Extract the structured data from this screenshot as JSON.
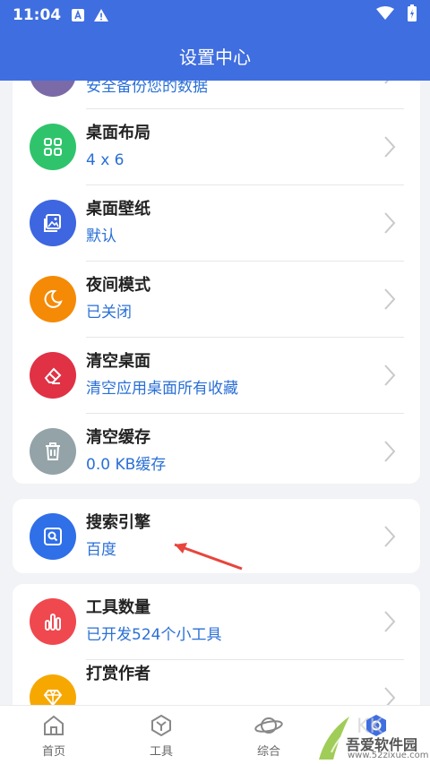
{
  "status_bar": {
    "time": "11:04"
  },
  "header": {
    "title": "设置中心"
  },
  "settings": {
    "top_partial_sub": "安全备份您的数据",
    "layout": {
      "title": "桌面布局",
      "sub": "4 x 6"
    },
    "wallpaper": {
      "title": "桌面壁纸",
      "sub": "默认"
    },
    "night": {
      "title": "夜间模式",
      "sub": "已关闭"
    },
    "clear_desktop": {
      "title": "清空桌面",
      "sub": "清空应用桌面所有收藏"
    },
    "clear_cache": {
      "title": "清空缓存",
      "sub": "0.0 KB缓存"
    },
    "search_engine": {
      "title": "搜索引擎",
      "sub": "百度"
    },
    "tool_count": {
      "title": "工具数量",
      "sub": "已开发524个小工具"
    },
    "reward": {
      "title": "打赏作者"
    }
  },
  "colors": {
    "purple": "#7a6aa8",
    "green": "#2fc46b",
    "blue": "#3d66e0",
    "orange": "#f58a07",
    "red": "#e03145",
    "gray": "#93a3a8",
    "search_blue": "#2f6fe8",
    "tool_red": "#f0484f",
    "reward_yellow": "#f7a800",
    "accent": "#3f6ee0",
    "arrow": "#e8453c"
  },
  "nav": {
    "home": "首页",
    "tools": "工具",
    "general": "综合"
  },
  "watermark": {
    "text": "吾爱软件园",
    "url": "www.52zixue.com"
  }
}
